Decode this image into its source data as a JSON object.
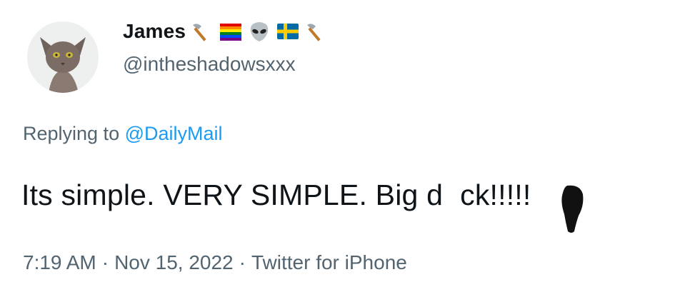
{
  "author": {
    "display_name": "James",
    "handle": "@intheshadowsxxx",
    "name_emojis": [
      "axe-emoji",
      "rainbow-flag-emoji",
      "alien-emoji",
      "sweden-flag-emoji",
      "axe-emoji"
    ]
  },
  "reply": {
    "prefix": "Replying to",
    "mention": "@DailyMail"
  },
  "tweet": {
    "text_before": "Its simple. VERY SIMPLE. Big d",
    "text_after": "ck!!!!!"
  },
  "meta": {
    "time": "7:19 AM",
    "separator": "·",
    "date": "Nov 15, 2022",
    "source": "Twitter for iPhone"
  },
  "colors": {
    "text_primary": "#0f1419",
    "text_secondary": "#536471",
    "link": "#1d9bf0"
  }
}
